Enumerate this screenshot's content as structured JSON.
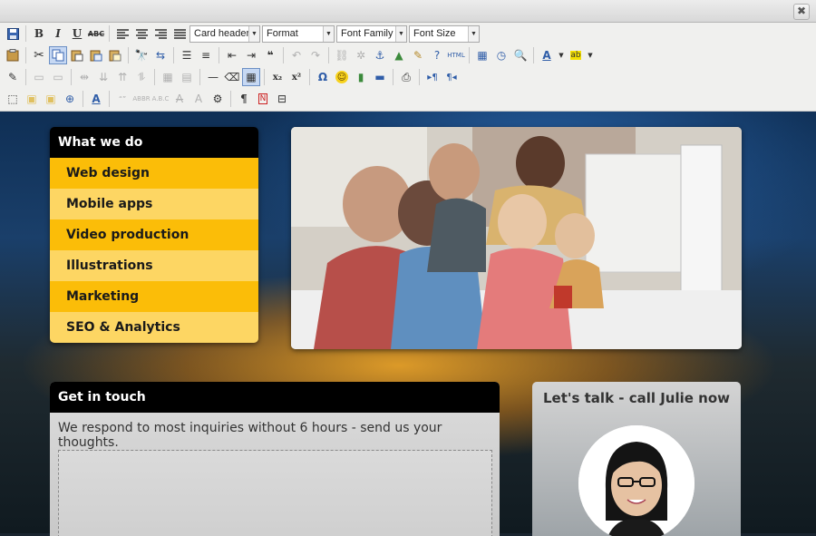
{
  "window": {
    "close_glyph": "✖"
  },
  "toolbar": {
    "card_header": "Card header",
    "format": "Format",
    "font_family": "Font Family",
    "font_size": "Font Size",
    "bold": "B",
    "italic": "I",
    "underline": "U",
    "strike": "ABC",
    "subscript": "x₂",
    "superscript": "x²",
    "omega": "Ω",
    "html": "HTML",
    "pilcrow": "¶"
  },
  "menu": {
    "title": "What we do",
    "items": [
      "Web design",
      "Mobile apps",
      "Video production",
      "Illustrations",
      "Marketing",
      "SEO & Analytics"
    ]
  },
  "contact": {
    "title": "Get in touch",
    "text": "We respond to most inquiries without 6 hours - send us your thoughts."
  },
  "talk": {
    "title": "Let's talk - call Julie now"
  },
  "colors": {
    "menu_primary": "#fbbd08",
    "menu_alt": "#fdd663",
    "header_bg": "#000000"
  }
}
